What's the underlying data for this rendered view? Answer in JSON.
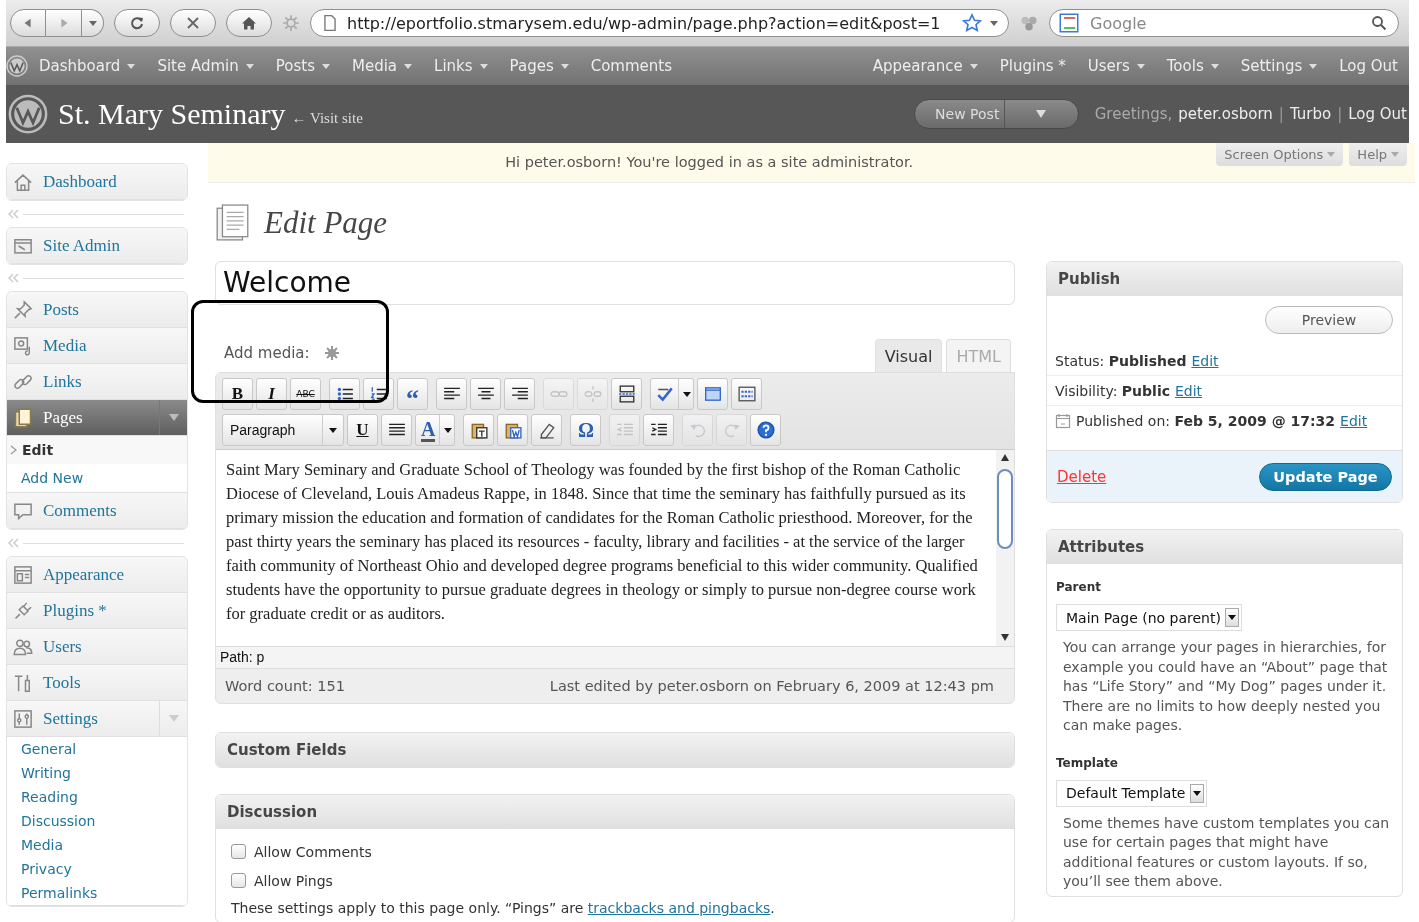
{
  "browser": {
    "url": "http://eportfolio.stmarysem.edu/wp-admin/page.php?action=edit&post=1",
    "search_placeholder": "Google"
  },
  "admin_menu_left": [
    {
      "label": "Dashboard",
      "has_menu": true
    },
    {
      "label": "Site Admin",
      "has_menu": true
    },
    {
      "label": "Posts",
      "has_menu": true
    },
    {
      "label": "Media",
      "has_menu": true
    },
    {
      "label": "Links",
      "has_menu": true
    },
    {
      "label": "Pages",
      "has_menu": true
    },
    {
      "label": "Comments",
      "has_menu": false
    }
  ],
  "admin_menu_right": [
    {
      "label": "Appearance",
      "has_menu": true
    },
    {
      "label": "Plugins *",
      "has_menu": false
    },
    {
      "label": "Users",
      "has_menu": true
    },
    {
      "label": "Tools",
      "has_menu": true
    },
    {
      "label": "Settings",
      "has_menu": true
    },
    {
      "label": "Log Out",
      "has_menu": false
    }
  ],
  "header": {
    "site_title": "St. Mary Seminary",
    "visit_link": "← Visit site",
    "new_post_button": "New Post",
    "greeting": "Greetings,",
    "user_links": [
      "peter.osborn",
      "Turbo",
      "Log Out"
    ],
    "separator": "|"
  },
  "notice": {
    "text": "Hi peter.osborn! You're logged in as a site administrator.",
    "tabs": [
      "Screen Options",
      "Help"
    ]
  },
  "sidebar": {
    "groups": [
      {
        "items": [
          {
            "label": "Dashboard",
            "kind": "house",
            "selected": false,
            "expanded": false
          }
        ]
      },
      {
        "items": [
          {
            "label": "Site Admin",
            "kind": "window",
            "selected": false,
            "expanded": false
          }
        ]
      },
      {
        "items": [
          {
            "label": "Posts",
            "kind": "pin",
            "selected": false,
            "expanded": false
          },
          {
            "label": "Media",
            "kind": "media",
            "selected": false,
            "expanded": false
          },
          {
            "label": "Links",
            "kind": "link",
            "selected": false,
            "expanded": false
          },
          {
            "label": "Pages",
            "kind": "pages",
            "selected": true,
            "expanded": true,
            "children": [
              {
                "label": "Edit",
                "selected": true
              },
              {
                "label": "Add New",
                "selected": false
              }
            ]
          },
          {
            "label": "Comments",
            "kind": "comment",
            "selected": false,
            "expanded": false
          }
        ]
      },
      {
        "items": [
          {
            "label": "Appearance",
            "kind": "appearance",
            "selected": false,
            "expanded": false
          },
          {
            "label": "Plugins *",
            "kind": "plug",
            "selected": false,
            "expanded": false
          },
          {
            "label": "Users",
            "kind": "users",
            "selected": false,
            "expanded": false
          },
          {
            "label": "Tools",
            "kind": "tools",
            "selected": false,
            "expanded": false
          },
          {
            "label": "Settings",
            "kind": "settings",
            "selected": false,
            "expanded": true,
            "children": [
              {
                "label": "General",
                "selected": false
              },
              {
                "label": "Writing",
                "selected": false
              },
              {
                "label": "Reading",
                "selected": false
              },
              {
                "label": "Discussion",
                "selected": false
              },
              {
                "label": "Media",
                "selected": false
              },
              {
                "label": "Privacy",
                "selected": false
              },
              {
                "label": "Permalinks",
                "selected": false
              }
            ]
          }
        ]
      }
    ]
  },
  "page_title": "Edit Page",
  "title_field": {
    "value": "Welcome"
  },
  "add_media_label": "Add media:",
  "editor_tabs": [
    {
      "label": "Visual",
      "selected": true
    },
    {
      "label": "HTML",
      "selected": false
    }
  ],
  "toolbar": {
    "rows": [
      [
        [
          {
            "kind": "bold",
            "label": "B",
            "disabled": false
          },
          {
            "kind": "italic",
            "label": "I",
            "disabled": false
          },
          {
            "kind": "strike",
            "label": "ABC",
            "disabled": false
          }
        ],
        [
          {
            "kind": "bullist",
            "disabled": false
          },
          {
            "kind": "numlist",
            "disabled": false
          },
          {
            "kind": "quote",
            "label": "“",
            "disabled": false
          }
        ],
        [
          {
            "kind": "alignleft",
            "disabled": false
          },
          {
            "kind": "aligncenter",
            "disabled": false
          },
          {
            "kind": "alignright",
            "disabled": false
          }
        ],
        [
          {
            "kind": "link",
            "disabled": true
          },
          {
            "kind": "unlink",
            "disabled": true
          },
          {
            "kind": "more",
            "disabled": false
          }
        ],
        [
          {
            "kind": "spellcheck",
            "disabled": false
          },
          {
            "kind": "fullscreen",
            "disabled": false
          },
          {
            "kind": "kitchen",
            "disabled": false
          }
        ]
      ],
      [
        [
          {
            "kind": "select",
            "label": "Paragraph",
            "disabled": false
          },
          {
            "kind": "underline",
            "label": "U",
            "disabled": false
          },
          {
            "kind": "justify",
            "disabled": false
          },
          {
            "kind": "forecolor",
            "label": "A",
            "disabled": false
          }
        ],
        [
          {
            "kind": "pastetext",
            "disabled": false
          },
          {
            "kind": "pasteword",
            "disabled": false
          },
          {
            "kind": "eraser",
            "disabled": false
          }
        ],
        [
          {
            "kind": "charmap",
            "label": "Ω",
            "disabled": false
          }
        ],
        [
          {
            "kind": "outdent",
            "disabled": true
          },
          {
            "kind": "indent",
            "disabled": false
          }
        ],
        [
          {
            "kind": "undo",
            "disabled": true
          },
          {
            "kind": "redo",
            "disabled": true
          },
          {
            "kind": "help",
            "disabled": false
          }
        ]
      ]
    ]
  },
  "content": "Saint Mary Seminary and Graduate School of Theology was founded by the first bishop of the Roman Catholic Diocese of Cleveland, Louis Amadeus Rappe, in 1848.  Since that time the seminary has faithfully pursued as its primary mission the education and formation of candidates for the Roman Catholic priesthood.  Moreover, for the past thirty years the seminary has placed its resources - faculty, library and facilities - at the service of the larger faith community of Northeast Ohio and developed degree programs beneficial to this wider community.  Qualified students have the opportunity to pursue graduate degrees in theology or simply to pursue non-degree course work for graduate credit or as auditors.",
  "path": "Path: p",
  "word_count": "Word count: 151",
  "last_edited": "Last edited by peter.osborn on February 6, 2009 at 12:43 pm",
  "custom_fields": {
    "title": "Custom Fields"
  },
  "discussion": {
    "title": "Discussion",
    "options": [
      {
        "label": "Allow Comments",
        "checked": false
      },
      {
        "label": "Allow Pings",
        "checked": false
      }
    ],
    "note": "These settings apply to this page only. “Pings” are ",
    "note_link": "trackbacks and pingbacks",
    "note_end": "."
  },
  "publish": {
    "title": "Publish",
    "preview_button": "Preview",
    "rows": [
      {
        "kind": "status",
        "label": "Status:",
        "value": "Published",
        "link": "Edit"
      },
      {
        "kind": "visibility",
        "label": "Visibility:",
        "value": "Public",
        "link": "Edit"
      },
      {
        "kind": "date",
        "label": "Published on:",
        "value": "Feb 5, 2009 @ 17:32",
        "link": "Edit"
      }
    ],
    "delete_link": "Delete",
    "update_button": "Update Page"
  },
  "attributes": {
    "title": "Attributes",
    "fields": [
      {
        "label": "Parent",
        "value": "Main Page (no parent)",
        "help": "You can arrange your pages in hierarchies, for example you could have an “About” page that has “Life Story” and “My Dog” pages under it. There are no limits to how deeply nested you can make pages."
      },
      {
        "label": "Template",
        "value": "Default Template",
        "help": "Some themes have custom templates you can use for certain pages that might have additional features or custom layouts. If so, you’ll see them above."
      }
    ]
  }
}
